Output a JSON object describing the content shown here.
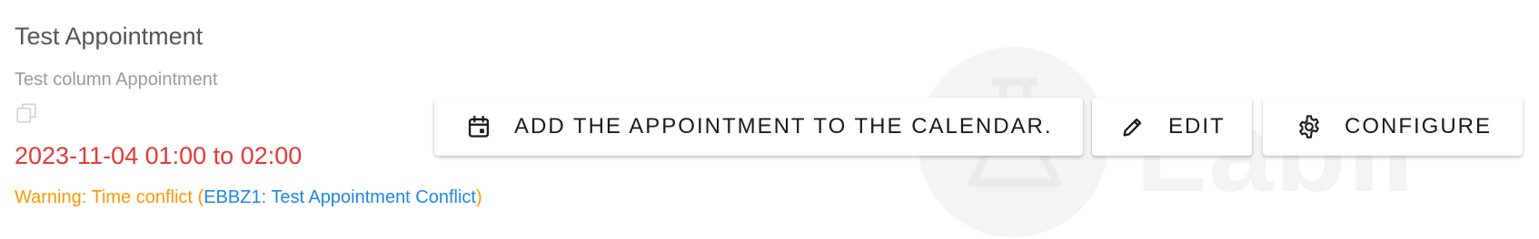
{
  "appointment": {
    "title": "Test Appointment",
    "column_label": "Test column Appointment",
    "datetime": "2023-11-04 01:00 to 02:00",
    "warning": {
      "prefix": "Warning: Time conflict (",
      "conflict_link": "EBBZ1: Test Appointment Conflict",
      "suffix": ")"
    }
  },
  "actions": {
    "add_to_calendar": {
      "label": "ADD THE APPOINTMENT TO THE CALENDAR.",
      "icon": "calendar-icon"
    },
    "edit": {
      "label": "EDIT",
      "icon": "pencil-icon"
    },
    "configure": {
      "label": "CONFIGURE",
      "icon": "gear-icon"
    }
  },
  "watermark": {
    "text": "LabII"
  },
  "colors": {
    "title": "#555555",
    "subtitle": "#9a9a9a",
    "datetime": "#e53935",
    "warning": "#ff9800",
    "link": "#1e88e5"
  }
}
